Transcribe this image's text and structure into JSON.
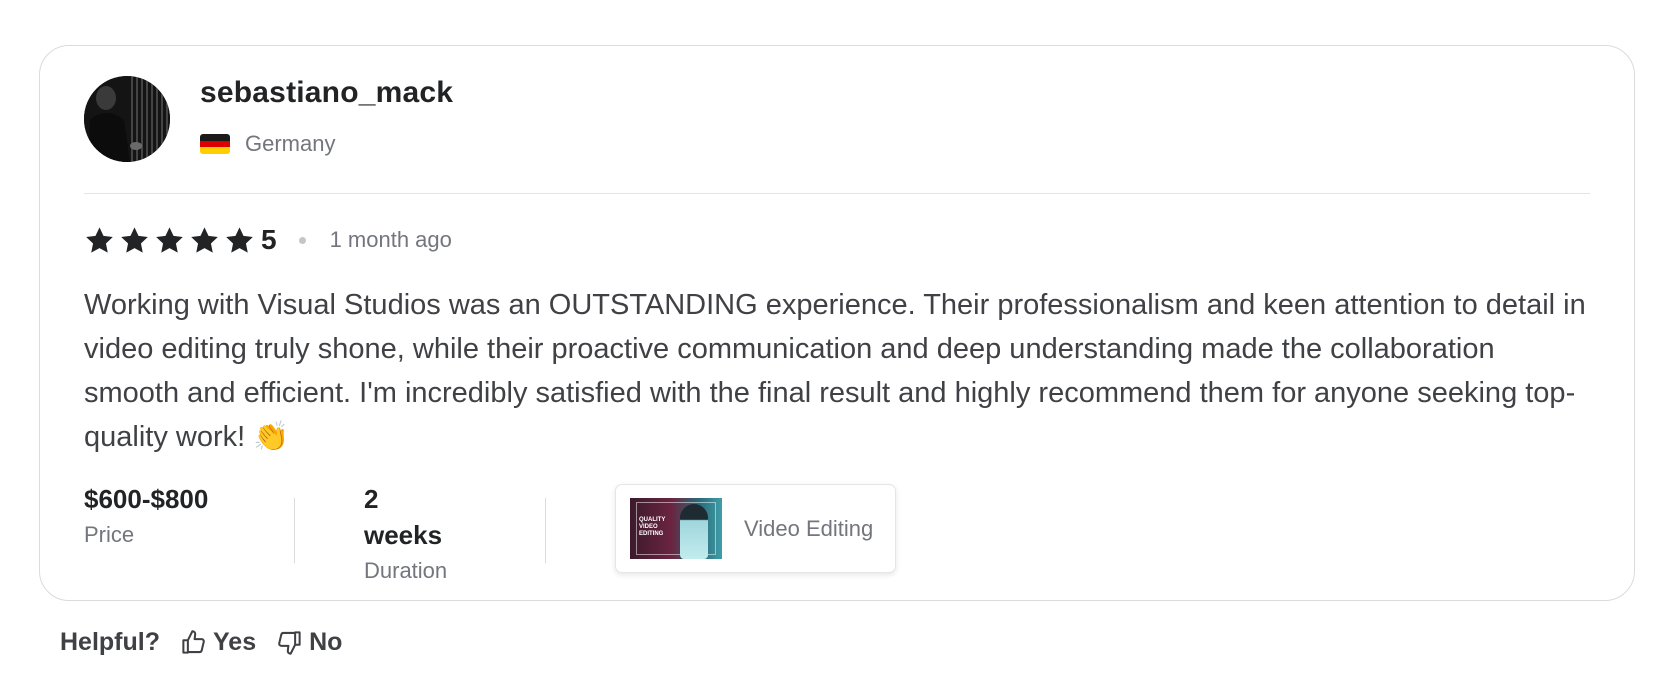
{
  "reviewer": {
    "username": "sebastiano_mack",
    "country": "Germany",
    "flag_colors": [
      "#000000",
      "#dd0000",
      "#ffce00"
    ]
  },
  "rating": {
    "stars": 5,
    "value": "5",
    "time_ago": "1 month ago"
  },
  "review": {
    "text": "Working with Visual Studios was an OUTSTANDING experience. Their professionalism and keen attention to detail in video editing truly shone, while their proactive communication and deep understanding made the collaboration smooth and efficient. I'm incredibly satisfied with the final result and highly recommend them for anyone seeking top-quality work! 👏"
  },
  "meta": {
    "price": {
      "value": "$600-$800",
      "label": "Price"
    },
    "duration": {
      "value": "2 weeks",
      "label": "Duration"
    }
  },
  "gig": {
    "label": "Video Editing",
    "thumbnail_text": "QUALITY\nVIDEO\nEDITING"
  },
  "helpful": {
    "label": "Helpful?",
    "yes_label": "Yes",
    "no_label": "No"
  },
  "colors": {
    "star": "#222325",
    "muted_text": "#74767e",
    "border": "#dadbdd"
  }
}
